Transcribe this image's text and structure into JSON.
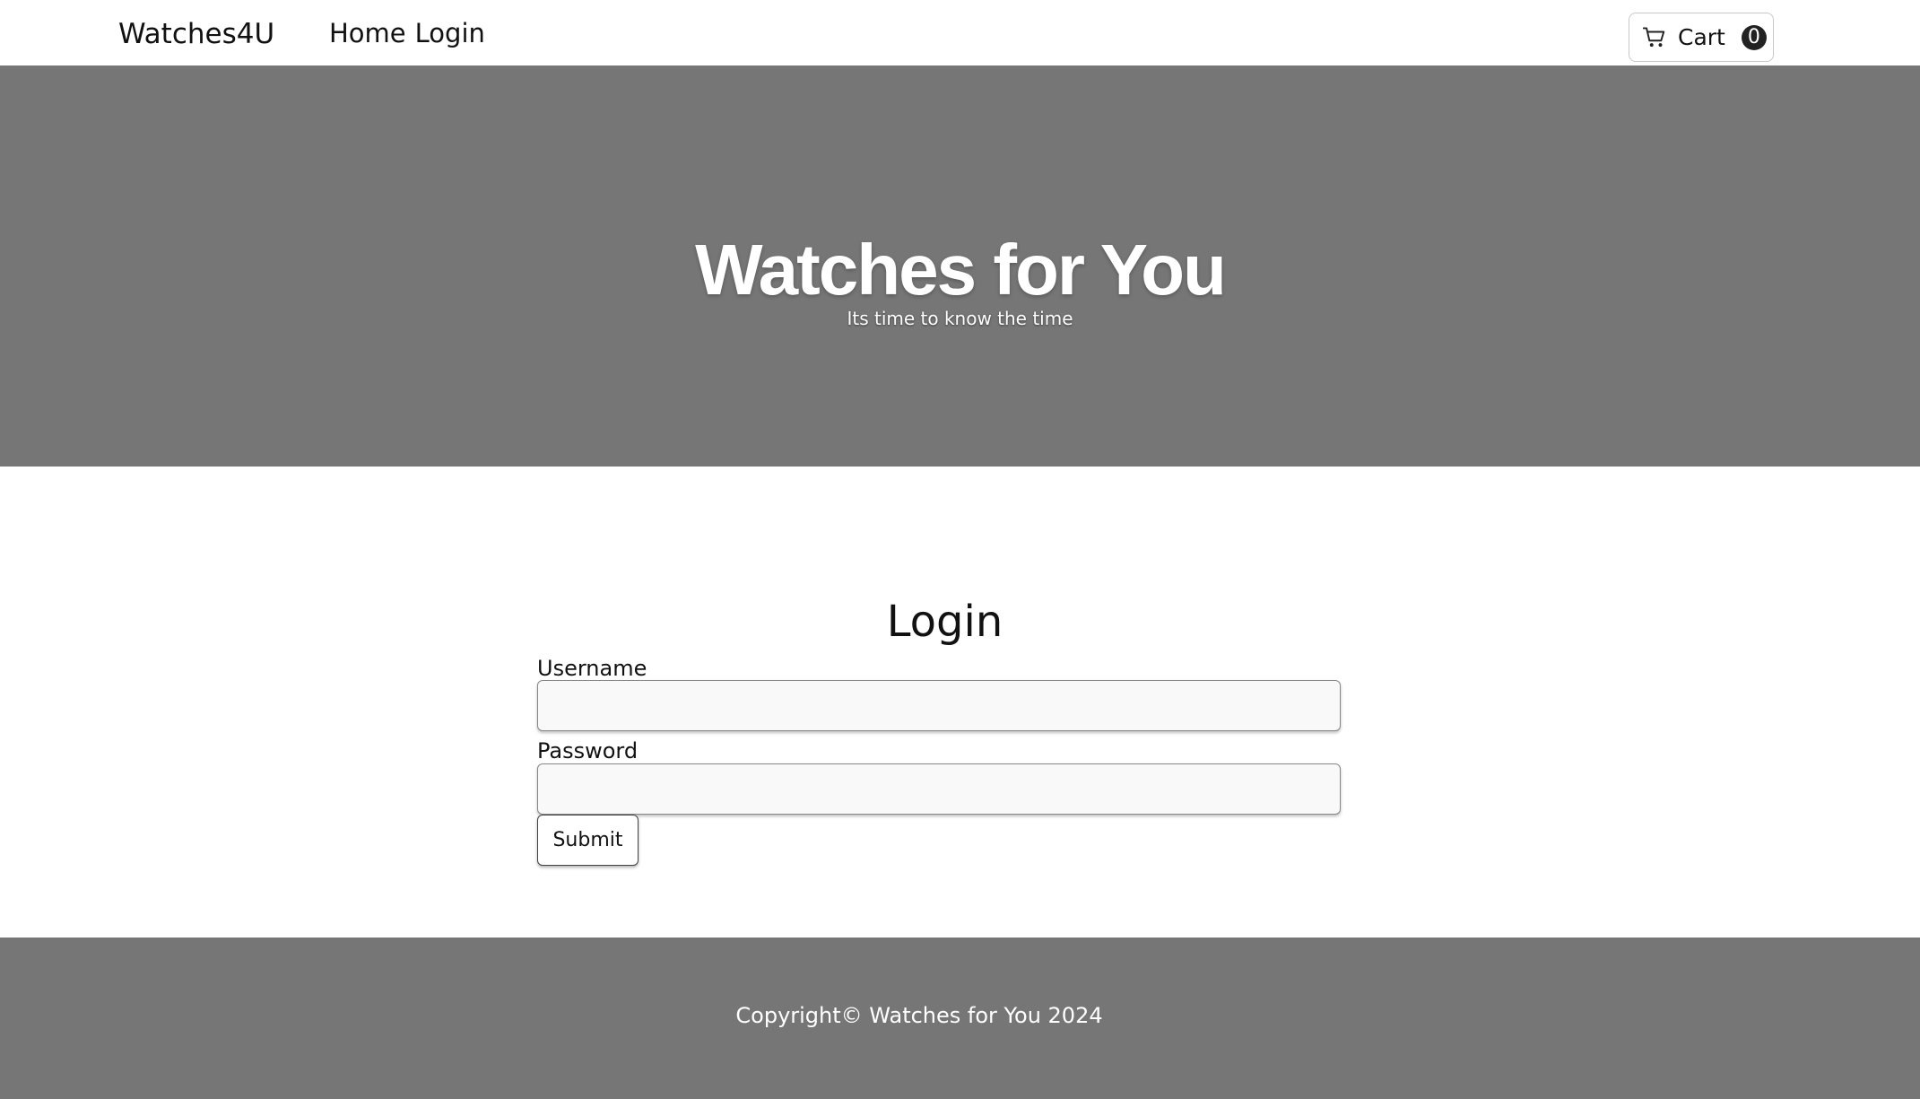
{
  "navbar": {
    "brand": "Watches4U",
    "links": [
      "Home",
      "Login"
    ],
    "cart": {
      "label": "Cart",
      "count": "0",
      "icon": "cart-icon"
    }
  },
  "hero": {
    "title": "Watches for You",
    "subtitle": "Its time to know the time",
    "background": "#767676"
  },
  "login": {
    "title": "Login",
    "username_label": "Username",
    "username_value": "",
    "password_label": "Password",
    "password_value": "",
    "submit_label": "Submit"
  },
  "footer": {
    "text": "Copyright© Watches for You 2024",
    "background": "#767676"
  }
}
